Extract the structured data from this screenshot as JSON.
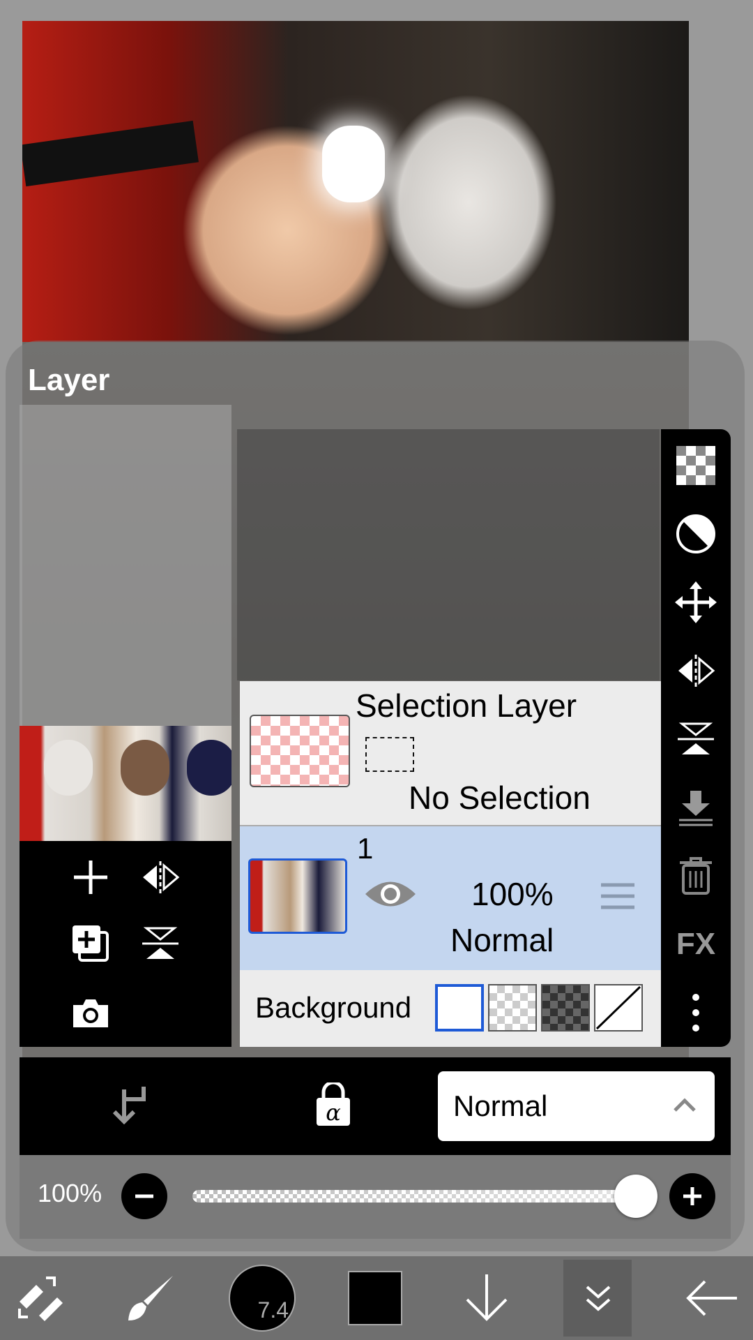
{
  "panel": {
    "title": "Layer"
  },
  "selection_layer": {
    "name": "Selection Layer",
    "status": "No Selection"
  },
  "layer": {
    "number": "1",
    "opacity": "100%",
    "blend": "Normal"
  },
  "background_row": {
    "label": "Background"
  },
  "blend_dropdown": {
    "value": "Normal"
  },
  "opacity": {
    "label": "100%",
    "value": 1.0
  },
  "brush": {
    "size": "7.4"
  },
  "colors": {
    "accent": "#1e5ad6",
    "layer_selected_bg": "#c4d6ef",
    "primary_color": "#000000"
  },
  "icons": {
    "left_tools": [
      "plus-icon",
      "flip-horizontal-icon",
      "add-layer-icon",
      "flip-vertical-icon",
      "camera-icon"
    ],
    "right_tools": [
      "transparency-icon",
      "contrast-icon",
      "move-icon",
      "flip-horizontal-icon",
      "flip-vertical-icon",
      "merge-down-icon",
      "trash-icon",
      "fx-icon",
      "more-icon"
    ],
    "action_bar": [
      "undo-return-icon",
      "alpha-lock-icon",
      "chevron-up-icon"
    ],
    "main_toolbar": [
      "transform-icon",
      "brush-icon",
      "brush-size-icon",
      "color-icon",
      "arrow-down-icon",
      "chevron-double-down-icon",
      "back-arrow-icon"
    ]
  },
  "right_tools_text": {
    "fx": "FX"
  }
}
